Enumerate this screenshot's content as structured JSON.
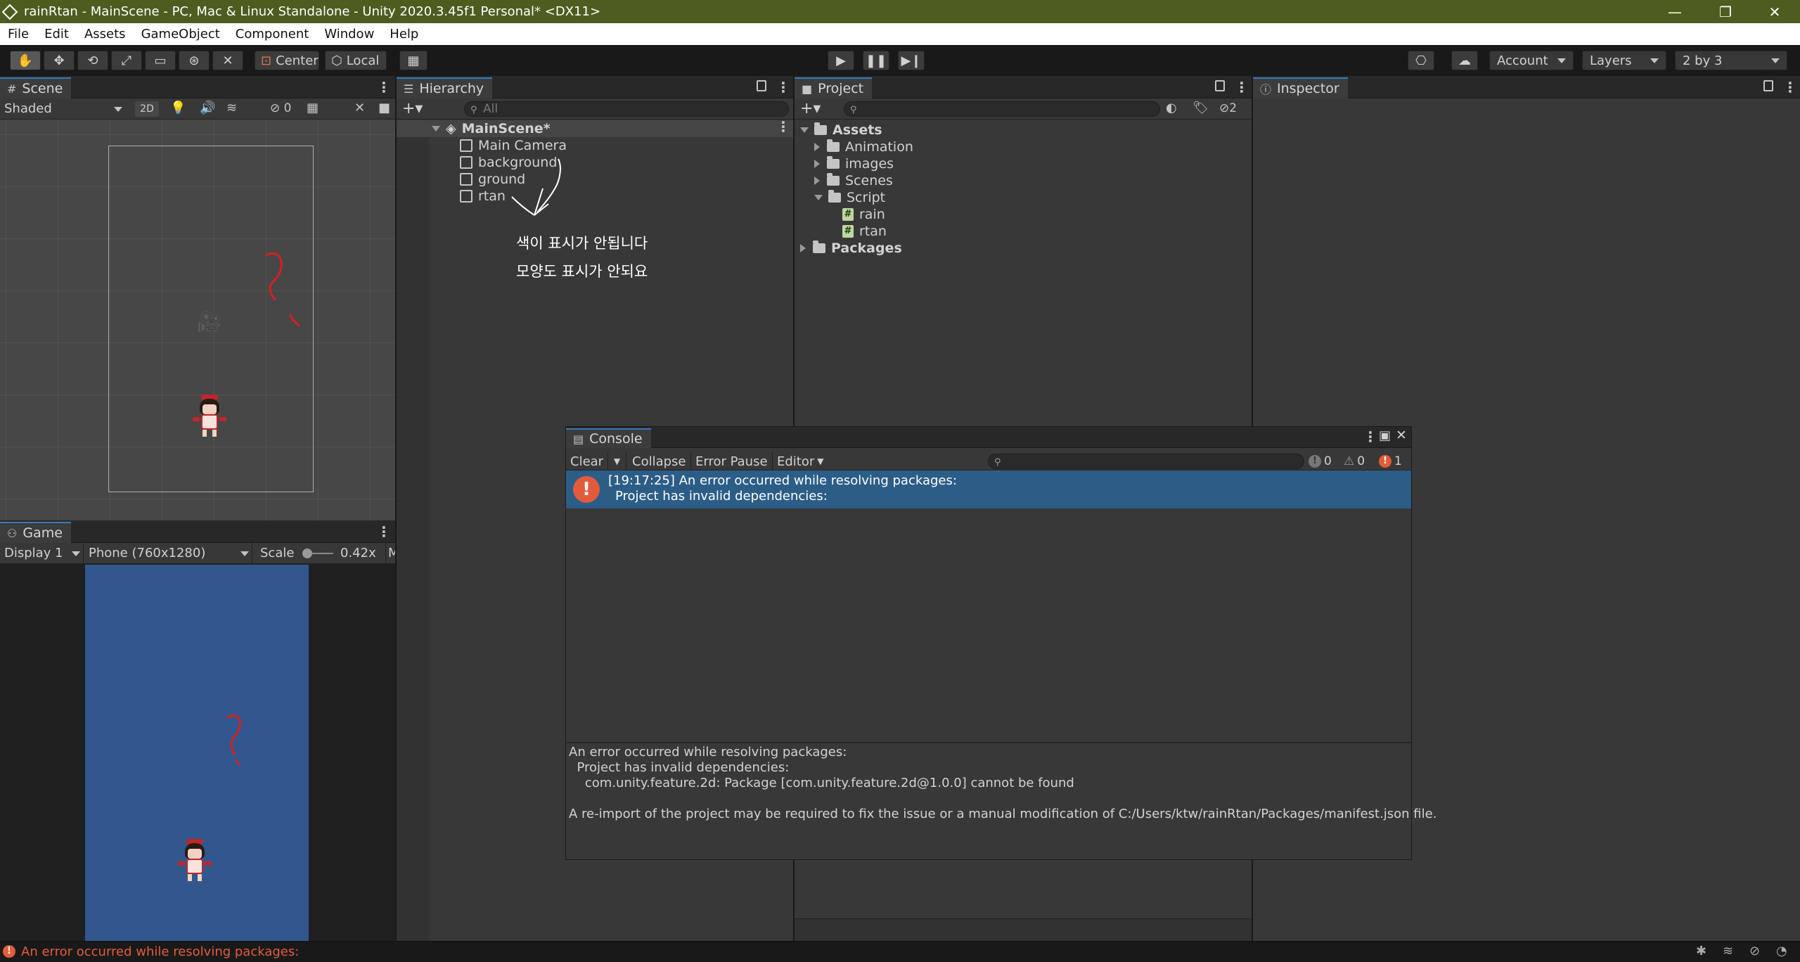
{
  "window": {
    "title": "rainRtan - MainScene - PC, Mac & Linux Standalone - Unity 2020.3.45f1 Personal* <DX11>",
    "controls": {
      "minimize": "—",
      "restore": "❐",
      "close": "✕"
    }
  },
  "menubar": [
    "File",
    "Edit",
    "Assets",
    "GameObject",
    "Component",
    "Window",
    "Help"
  ],
  "toolbar": {
    "pivot_label": "Center",
    "space_label": "Local",
    "account_label": "Account",
    "layers_label": "Layers",
    "layout_label": "2 by 3"
  },
  "scene": {
    "tab_label": "Scene",
    "shading_mode": "Shaded",
    "mode_2d": "2D",
    "hidden_count": "0"
  },
  "game": {
    "tab_label": "Game",
    "display": "Display 1",
    "resolution": "Phone (760x1280)",
    "scale_label": "Scale",
    "scale_value": "0.42x",
    "maximize_abbrev": "M"
  },
  "hierarchy": {
    "tab_label": "Hierarchy",
    "search_placeholder": "All",
    "scene_name": "MainScene*",
    "items": [
      "Main Camera",
      "background",
      "ground",
      "rtan"
    ],
    "annotation_lines": [
      "색이 표시가 안됩니다",
      "모양도 표시가 안되요"
    ]
  },
  "project": {
    "tab_label": "Project",
    "hidden_count": "2",
    "assets_label": "Assets",
    "folders": [
      "Animation",
      "images",
      "Scenes",
      "Script"
    ],
    "scripts": [
      "rain",
      "rtan"
    ],
    "packages_label": "Packages"
  },
  "inspector": {
    "tab_label": "Inspector"
  },
  "console": {
    "tab_label": "Console",
    "clear_label": "Clear",
    "collapse_label": "Collapse",
    "error_pause_label": "Error Pause",
    "editor_label": "Editor",
    "log_count": "0",
    "warning_count": "0",
    "error_count": "1",
    "entry_line1": "[19:17:25] An error occurred while resolving packages:",
    "entry_line2": "Project has invalid dependencies:",
    "detail_lines": [
      "An error occurred while resolving packages:",
      "  Project has invalid dependencies:",
      "    com.unity.feature.2d: Package [com.unity.feature.2d@1.0.0] cannot be found",
      "",
      "A re-import of the project may be required to fix the issue or a manual modification of C:/Users/ktw/rainRtan/Packages/manifest.json file."
    ]
  },
  "statusbar": {
    "message": "An error occurred while resolving packages:"
  },
  "colors": {
    "titlebar": "#4d5d1f",
    "selection": "#2c5d87",
    "error": "#e25c3c",
    "game_bg": "#31578e",
    "annotation": "#d42020"
  }
}
